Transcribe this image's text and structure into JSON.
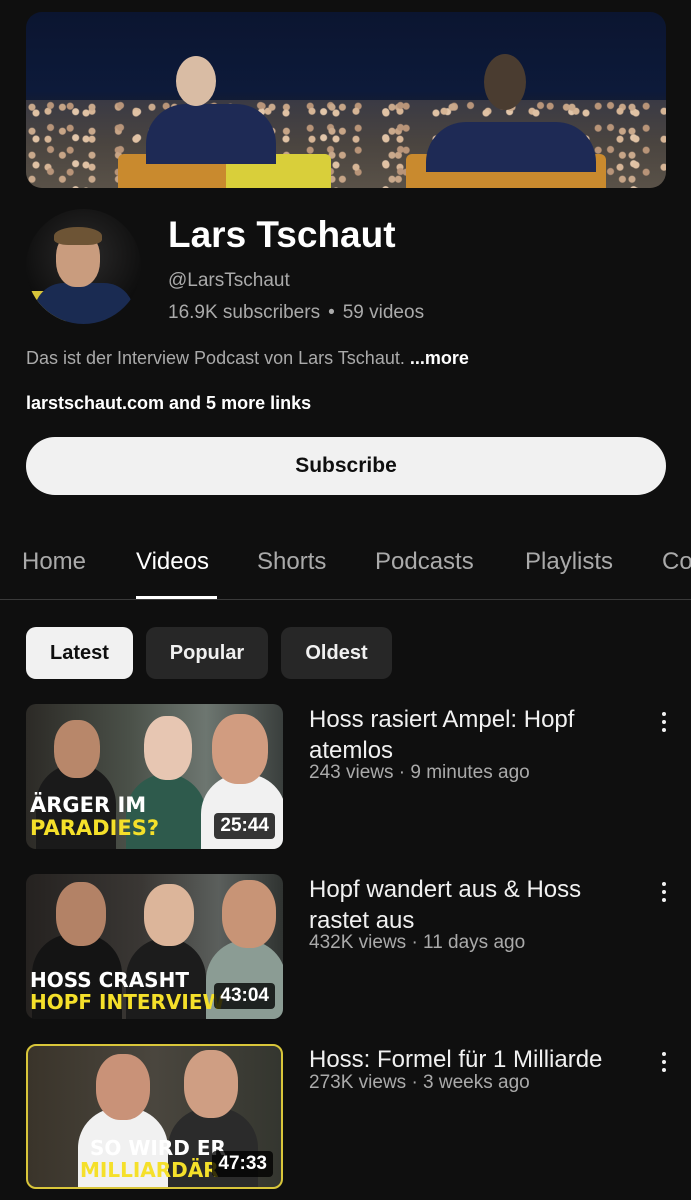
{
  "channel": {
    "name": "Lars Tschaut",
    "handle": "@LarsTschaut",
    "subscribers": "16.9K subscribers",
    "separator": "•",
    "videos_count": "59 videos",
    "description": "Das ist der Interview Podcast von Lars Tschaut.",
    "more_label": "...more",
    "links": "larstschaut.com and 5 more links",
    "subscribe_label": "Subscribe"
  },
  "tabs": [
    "Home",
    "Videos",
    "Shorts",
    "Podcasts",
    "Playlists",
    "Co"
  ],
  "active_tab": "Videos",
  "filters": [
    "Latest",
    "Popular",
    "Oldest"
  ],
  "active_filter": "Latest",
  "videos": [
    {
      "title": "Hoss rasiert Ampel: Hopf atemlos",
      "meta": "243 views · 9 minutes ago",
      "duration": "25:44",
      "thumb_line1": "ÄRGER IM",
      "thumb_line2": "PARADIES?"
    },
    {
      "title": "Hopf wandert aus & Hoss rastet aus",
      "meta": "432K views · 11 days ago",
      "duration": "43:04",
      "thumb_line1": "HOSS CRASHT",
      "thumb_line2": "HOPF INTERVIEW"
    },
    {
      "title": "Hoss: Formel für 1 Milliarde",
      "meta": "273K views · 3 weeks ago",
      "duration": "47:33",
      "thumb_line1": "SO WIRD ER",
      "thumb_line2": "MILLIARDÄR"
    }
  ],
  "colors": {
    "background": "#0f0f0f",
    "text_primary": "#f1f1f1",
    "text_secondary": "#aaaaaa",
    "chip_unselected": "#272727",
    "thumb_highlight_yellow": "#f5e02a"
  }
}
